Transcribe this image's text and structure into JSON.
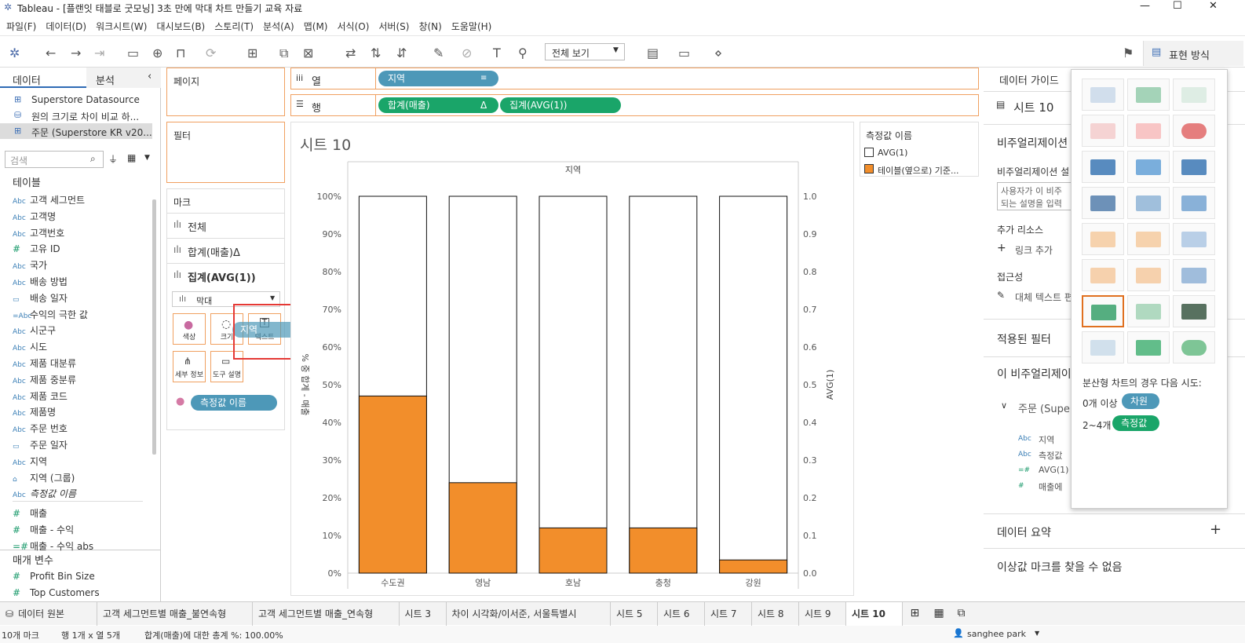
{
  "window": {
    "title": "Tableau - [플랜잇 태블로 굿모닝] 3초 만에 막대 차트 만들기 교육 자료"
  },
  "menu": [
    "파일(F)",
    "데이터(D)",
    "워크시트(W)",
    "대시보드(B)",
    "스토리(T)",
    "분석(A)",
    "맵(M)",
    "서식(O)",
    "서버(S)",
    "창(N)",
    "도움말(H)"
  ],
  "toolbar": {
    "fit_select": "전체 보기",
    "showme_label": "표현 방식"
  },
  "left": {
    "tab_data": "데이터",
    "tab_analysis": "분석",
    "datasources": [
      "Superstore Datasource",
      "원의 크기로 차이 비교 하...",
      "주문 (Superstore KR v20..."
    ],
    "search_placeholder": "검색",
    "tables_header": "테이블",
    "fields": [
      {
        "icon": "Abc",
        "name": "고객 세그먼트"
      },
      {
        "icon": "Abc",
        "name": "고객명"
      },
      {
        "icon": "Abc",
        "name": "고객번호"
      },
      {
        "icon": "#",
        "name": "고유 ID"
      },
      {
        "icon": "Abc",
        "name": "국가"
      },
      {
        "icon": "Abc",
        "name": "배송 방법"
      },
      {
        "icon": "cal",
        "name": "배송 일자"
      },
      {
        "icon": "=Abc",
        "name": "수익의 극한 값"
      },
      {
        "icon": "Abc",
        "name": "시군구"
      },
      {
        "icon": "Abc",
        "name": "시도"
      },
      {
        "icon": "Abc",
        "name": "제품 대분류"
      },
      {
        "icon": "Abc",
        "name": "제품 중분류"
      },
      {
        "icon": "Abc",
        "name": "제품 코드"
      },
      {
        "icon": "Abc",
        "name": "제품명"
      },
      {
        "icon": "Abc",
        "name": "주문 번호"
      },
      {
        "icon": "cal",
        "name": "주문 일자"
      },
      {
        "icon": "Abc",
        "name": "지역"
      },
      {
        "icon": "clip",
        "name": "지역 (그룹)"
      },
      {
        "icon": "Abc",
        "name": "측정값 이름"
      },
      {
        "icon": "#",
        "name": "매출"
      },
      {
        "icon": "#",
        "name": "매출 - 수익"
      },
      {
        "icon": "=#",
        "name": "매출 - 수익 abs"
      }
    ],
    "params_header": "매개 변수",
    "params": [
      {
        "icon": "#",
        "name": "Profit Bin Size"
      },
      {
        "icon": "#",
        "name": "Top Customers"
      }
    ]
  },
  "shelves": {
    "pages": "페이지",
    "filters": "필터",
    "marks": "마크",
    "columns": "열",
    "rows": "행",
    "col_pill": "지역",
    "row_pill1": "합계(매출)",
    "row_pill1_delta": "Δ",
    "row_pill2": "집계(AVG(1))"
  },
  "marks": {
    "all": "전체",
    "m1": "합계(매출)Δ",
    "m2": "집계(AVG(1))",
    "type": "막대",
    "cards": [
      "색상",
      "크기",
      "텍스트",
      "세부 정보",
      "도구 설명"
    ],
    "color_pill": "측정값 이름",
    "drag_pill": "지역"
  },
  "sheet": {
    "title": "시트 10",
    "col_header": "지역",
    "left_axis": "% 중 합계 - 매출",
    "right_axis": "AVG(1)"
  },
  "chart_data": {
    "type": "bar",
    "categories": [
      "수도권",
      "영남",
      "호남",
      "충청",
      "강원"
    ],
    "series": [
      {
        "name": "AVG(1)",
        "values": [
          1.0,
          1.0,
          1.0,
          1.0,
          1.0
        ]
      },
      {
        "name": "테이블(옆으로) 기준...",
        "values": [
          47,
          24,
          12,
          12,
          3.5
        ]
      }
    ],
    "left_ticks": [
      "100%",
      "90%",
      "80%",
      "70%",
      "60%",
      "50%",
      "40%",
      "30%",
      "20%",
      "10%",
      "0%"
    ],
    "right_ticks": [
      "1.0",
      "0.9",
      "0.8",
      "0.7",
      "0.6",
      "0.5",
      "0.4",
      "0.3",
      "0.2",
      "0.1",
      "0.0"
    ],
    "ylim": [
      0,
      100
    ],
    "colors": {
      "avg": "#ffffff",
      "pct": "#f28e2b"
    }
  },
  "legend": {
    "title": "측정값 이름",
    "items": [
      "AVG(1)",
      "테이블(옆으로) 기준..."
    ]
  },
  "right": {
    "guide": "데이터 가이드",
    "sheet": "시트 10",
    "viz_title": "비주얼리제이션",
    "viz_desc_label": "비주얼리제이션 설",
    "desc1": "사용자가 이 비주",
    "desc2": "되는 설명을 입력",
    "resources": "추가 리소스",
    "add_link": "링크 추가",
    "access": "접근성",
    "alt_text": "대체 텍스트 편",
    "applied_filters": "적용된 필터",
    "this_viz": "이 비주얼리제이",
    "source": "주문 (Supe",
    "fields": [
      {
        "icon": "Abc",
        "name": "지역"
      },
      {
        "icon": "Abc",
        "name": "측정값"
      },
      {
        "icon": "=#",
        "name": "AVG(1)"
      },
      {
        "icon": "#",
        "name": "매출에"
      }
    ],
    "data_summary": "데이터 요약",
    "outliers": "이상값 마크를 찾을 수 없음"
  },
  "showme": {
    "hint": "분산형 차트의 경우 다음 시도:",
    "line1": "0개 이상",
    "line1_pill": "차원",
    "line2": "2~4개",
    "line2_pill": "측정값"
  },
  "tabs": [
    "데이터 원본",
    "고객 세그먼트별 매출_불연속형",
    "고객 세그먼트별 매출_연속형",
    "시트 3",
    "차이 시각화/이서준, 서울특별시",
    "시트 5",
    "시트 6",
    "시트 7",
    "시트 8",
    "시트 9",
    "시트 10"
  ],
  "status": {
    "marks": "10개 마크",
    "rows": "행 1개 x 열 5개",
    "sum": "합계(매출)에 대한 총계 %: 100.00%",
    "user": "sanghee park"
  }
}
